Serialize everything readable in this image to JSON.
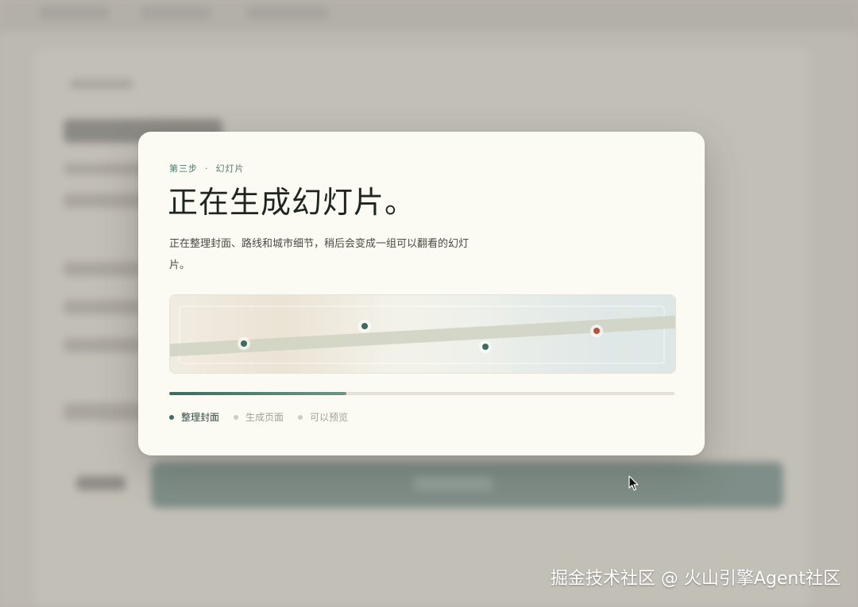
{
  "dialog": {
    "step": "第三步",
    "step_separator": "·",
    "step_name": "幻灯片",
    "title": "正在生成幻灯片。",
    "description": "正在整理封面、路线和城市细节，稍后会变成一组可以翻看的幻灯片。",
    "progress": 0.35,
    "stages": [
      {
        "label": "整理封面",
        "state": "active"
      },
      {
        "label": "生成页面",
        "state": "pending"
      },
      {
        "label": "可以预览",
        "state": "pending"
      }
    ]
  },
  "colors": {
    "accent": "#3f6b61",
    "route_dot": "#3f6b61",
    "destination_dot": "#b5533c",
    "card_bg": "#fbfaf3"
  },
  "watermark": "掘金技术社区 @ 火山引擎Agent社区"
}
